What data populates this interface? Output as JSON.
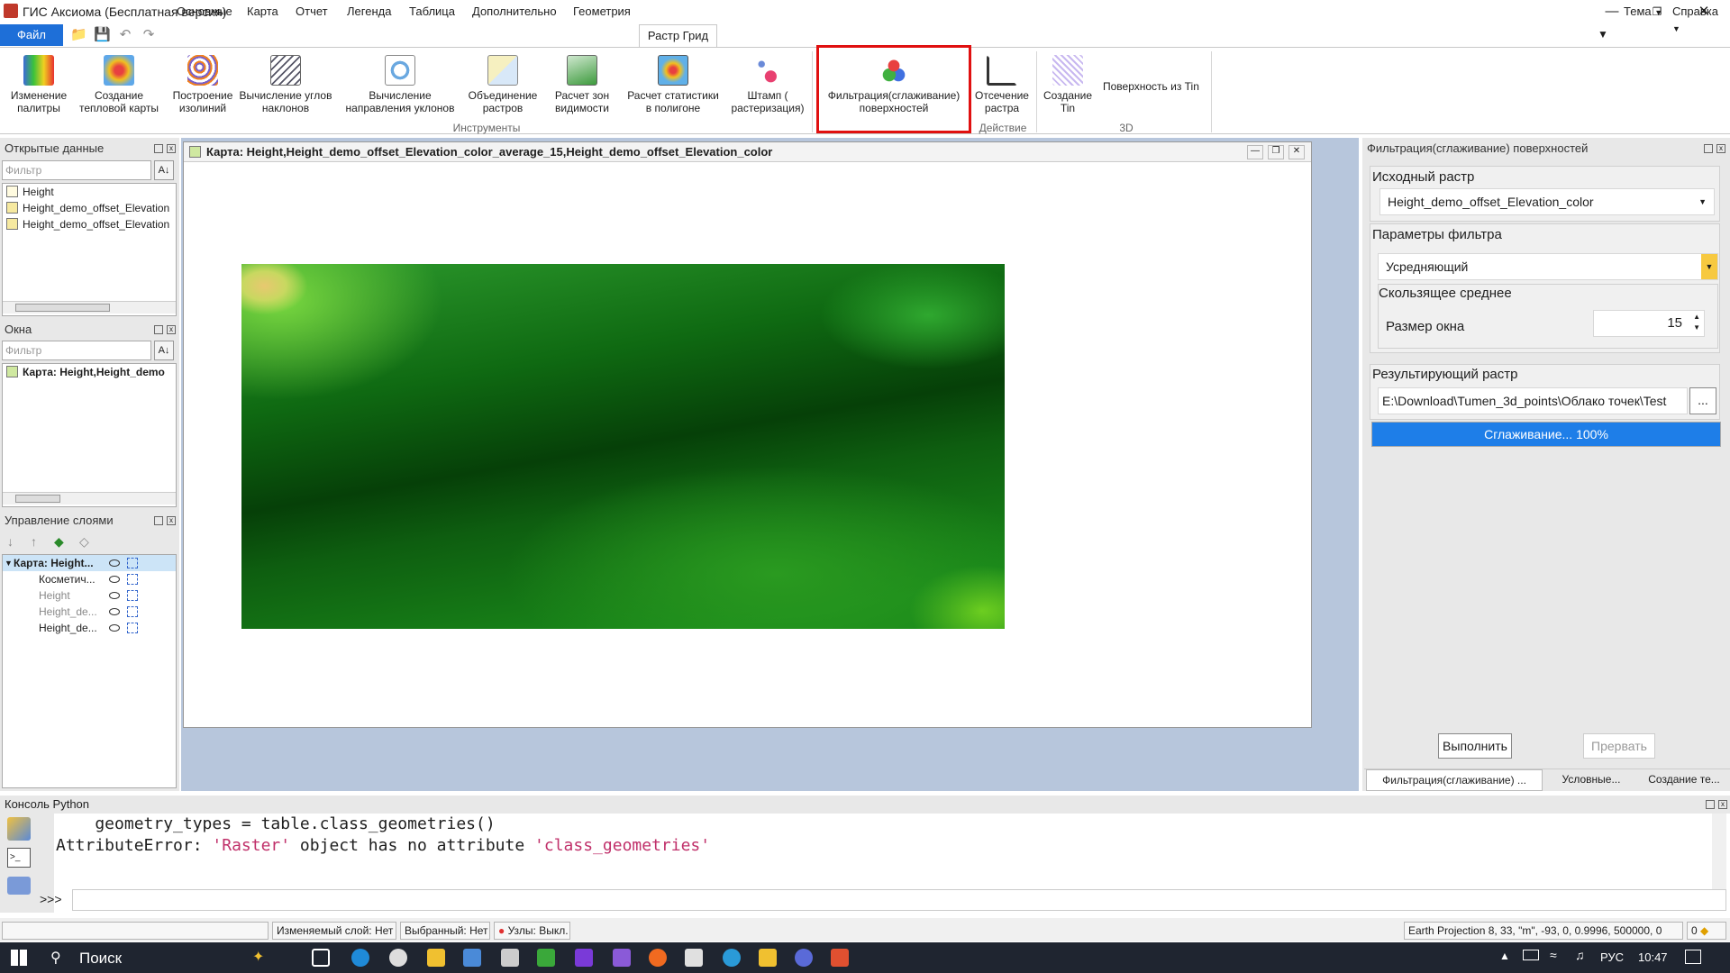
{
  "window": {
    "title": "ГИС Аксиома (Бесплатная версия)"
  },
  "menu": {
    "file": "Файл",
    "tabs": [
      "Основные",
      "Карта",
      "Отчет",
      "Легенда",
      "Таблица",
      "Дополнительно",
      "Геометрия"
    ],
    "active_tab": "Растр Грид",
    "right": [
      "Тема",
      "Справка"
    ]
  },
  "ribbon": {
    "buttons": [
      [
        "Изменение",
        "палитры"
      ],
      [
        "Создание",
        "тепловой карты"
      ],
      [
        "Построение",
        "изолиний"
      ],
      [
        "Вычисление углов",
        "наклонов"
      ],
      [
        "Вычисление",
        "направления уклонов"
      ],
      [
        "Объединение",
        "растров"
      ],
      [
        "Расчет зон",
        "видимости"
      ],
      [
        "Расчет статистики",
        "в полигоне"
      ],
      [
        "Штамп (",
        "растеризация)"
      ],
      [
        "Фильтрация(сглаживание)",
        "поверхностей"
      ],
      [
        "Отсечение",
        "растра"
      ],
      [
        "Создание",
        "Tin"
      ]
    ],
    "tin_surface": "Поверхность из Tin",
    "groups": {
      "tools": "Инструменты",
      "action": "Действие",
      "three_d": "3D"
    }
  },
  "open_data": {
    "title": "Открытые данные",
    "filter_placeholder": "Фильтр",
    "items": [
      "Height",
      "Height_demo_offset_Elevation",
      "Height_demo_offset_Elevation"
    ]
  },
  "windows": {
    "title": "Окна",
    "filter_placeholder": "Фильтр",
    "items": [
      "Карта: Height,Height_demo"
    ]
  },
  "layers": {
    "title": "Управление слоями",
    "root": "Карта: Height...",
    "items": [
      "Косметич...",
      "Height",
      "Height_de...",
      "Height_de..."
    ]
  },
  "map": {
    "title": "Карта: Height,Height_demo_offset_Elevation_color_average_15,Height_demo_offset_Elevation_color"
  },
  "filter_panel": {
    "title": "Фильтрация(сглаживание) поверхностей",
    "source_label": "Исходный растр",
    "source_value": "Height_demo_offset_Elevation_color",
    "params_label": "Параметры фильтра",
    "filter_type": "Усредняющий",
    "moving_avg": "Скользящее среднее",
    "window_size_label": "Размер окна",
    "window_size": "15",
    "result_label": "Результирующий растр",
    "result_path": "E:\\Download\\Tumen_3d_points\\Облако точек\\Test",
    "browse": "...",
    "progress_text": "Сглаживание... 100%",
    "progress": 100,
    "run": "Выполнить",
    "abort": "Прервать",
    "tabs": [
      "Фильтрация(сглаживание) ...",
      "Условные...",
      "Создание те..."
    ]
  },
  "console": {
    "title": "Консоль Python",
    "line1": "    geometry_types = table.class_geometries()",
    "line2_a": "AttributeError: ",
    "line2_b": "'Raster'",
    "line2_c": " object has no attribute ",
    "line2_d": "'class_geometries'",
    "prompt": ">>>"
  },
  "status": {
    "edit_layer": "Изменяемый слой: Нет",
    "selected": "Выбранный: Нет",
    "nodes": "Узлы: Выкл.",
    "projection": "Earth Projection 8, 33, \"m\", -93, 0, 0.9996, 500000, 0",
    "count": "0"
  },
  "taskbar": {
    "search": "Поиск",
    "lang": "РУС",
    "time": "10:47"
  },
  "colors": {
    "accent": "#1e6fd8",
    "highlight": "#e01010",
    "progress": "#1e7ee8"
  }
}
